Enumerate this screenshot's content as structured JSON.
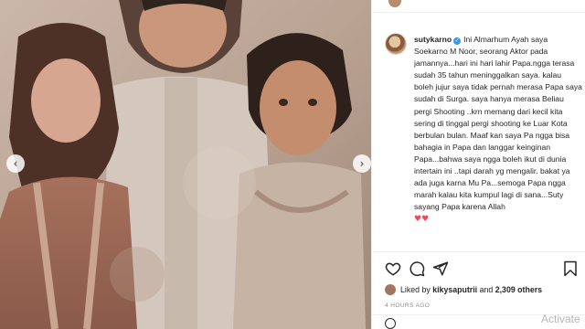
{
  "post": {
    "username": "sutykarno",
    "caption_body": "Ini Almarhum Ayah saya Soekarno M Noor, seorang Aktor pada jamannya...hari ini hari lahir Papa.ngga terasa sudah 35 tahun meninggalkan saya. kalau boleh jujur saya tidak pernah merasa Papa saya sudah di Surga. saya hanya merasa Beliau pergi Shooting ..krn memang dari kecil kita sering di tinggal pergi shooting ke Luar Kota berbulan bulan. Maaf kan saya Pa ngga bisa bahagia in Papa dan langgar keinginan Papa...bahwa saya ngga boleh ikut di dunia intertain ini ..tapi darah yg mengalir. bakat ya ada juga karna Mu Pa...semoga Papa ngga marah kalau kita kumpul lagi di sana...Suty sayang Papa karena Allah",
    "hearts": "♥♥",
    "verified_glyph": "✓"
  },
  "likes": {
    "prefix": "Liked by",
    "user": "kikysaputrii",
    "connector": "and",
    "others": "2,309 others"
  },
  "timestamp": "4 HOURS AGO",
  "watermark": "Activate",
  "icons": {
    "prev": "chevron-left-icon",
    "next": "chevron-right-icon",
    "like": "heart-icon",
    "comment": "comment-icon",
    "share": "share-icon",
    "save": "bookmark-icon"
  },
  "colors": {
    "verified": "#3897f0",
    "heart": "#ed4956",
    "text": "#262626",
    "muted": "#8e8e8e"
  }
}
